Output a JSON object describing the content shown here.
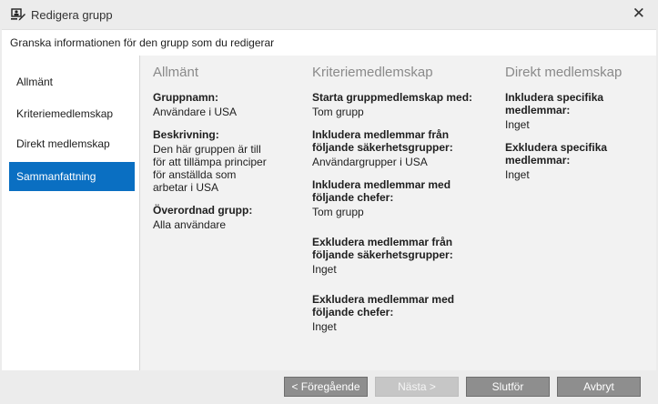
{
  "window": {
    "title": "Redigera grupp",
    "close_glyph": "✕",
    "icon": "group-edit-icon"
  },
  "instruction": "Granska informationen för den grupp som du redigerar",
  "nav": {
    "items": [
      {
        "label": "Allmänt"
      },
      {
        "label": "Kriteriemedlemskap"
      },
      {
        "label": "Direkt medlemskap"
      },
      {
        "label": "Sammanfattning",
        "selected": true
      }
    ]
  },
  "summary": {
    "general": {
      "heading": "Allmänt",
      "fields": [
        {
          "label": "Gruppnamn:",
          "value": "Användare i USA"
        },
        {
          "label": "Beskrivning:",
          "value": "Den här gruppen är till\nför att tillämpa principer\nför anställda som\narbetar i USA"
        },
        {
          "label": "Överordnad grupp:",
          "value": "Alla användare"
        }
      ]
    },
    "criteria": {
      "heading": "Kriteriemedlemskap",
      "fields": [
        {
          "label": "Starta gruppmedlemskap med:",
          "value": "Tom grupp"
        },
        {
          "label": "Inkludera medlemmar från\nföljande säkerhetsgrupper:",
          "value": "Användargrupper i USA"
        },
        {
          "label": "Inkludera medlemmar med\nföljande chefer:",
          "value": "Tom grupp"
        },
        {
          "label": "Exkludera medlemmar från\nföljande säkerhetsgrupper:",
          "value": "Inget"
        },
        {
          "label": "Exkludera medlemmar med\nföljande chefer:",
          "value": "Inget"
        }
      ]
    },
    "direct": {
      "heading": "Direkt medlemskap",
      "fields": [
        {
          "label": "Inkludera specifika\nmedlemmar:",
          "value": "Inget"
        },
        {
          "label": "Exkludera specifika\nmedlemmar:",
          "value": "Inget"
        }
      ]
    }
  },
  "footer": {
    "previous": "< Föregående",
    "next": "Nästa >",
    "finish": "Slutför",
    "cancel": "Avbryt"
  },
  "colors": {
    "accent": "#0a6fc2",
    "button": "#8e8e8e",
    "button_disabled": "#c6c6c6"
  }
}
